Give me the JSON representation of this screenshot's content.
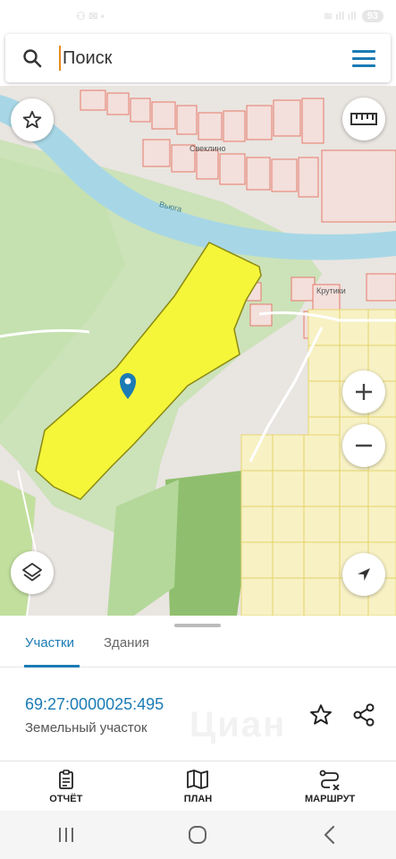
{
  "status_bar": {
    "time": "11:23",
    "carrier": "Я",
    "battery": "93"
  },
  "search": {
    "placeholder": "Поиск",
    "value": ""
  },
  "map": {
    "labels": {
      "river": "Вьюга",
      "village_1": "Свеклино",
      "village_2": "Крутики"
    },
    "parcel_fill_color": "#f5f53a",
    "marker_color": "#1b7bb5"
  },
  "tabs": {
    "parcels": "Участки",
    "buildings": "Здания",
    "active": "Участки"
  },
  "parcel": {
    "cadastral_number": "69:27:0000025:495",
    "type": "Земельный участок"
  },
  "watermark": "Циан",
  "bottom_nav": {
    "report": "ОТЧЁТ",
    "plan": "ПЛАН",
    "route": "МАРШРУТ"
  },
  "icons": {
    "search": "search-icon",
    "menu": "hamburger-icon",
    "star": "star-icon",
    "ruler": "ruler-icon",
    "zoom_in": "plus-icon",
    "zoom_out": "minus-icon",
    "layers": "layers-icon",
    "locate": "navigation-arrow-icon",
    "share": "share-icon",
    "report": "clipboard-icon",
    "plan": "map-icon",
    "route": "route-icon"
  }
}
